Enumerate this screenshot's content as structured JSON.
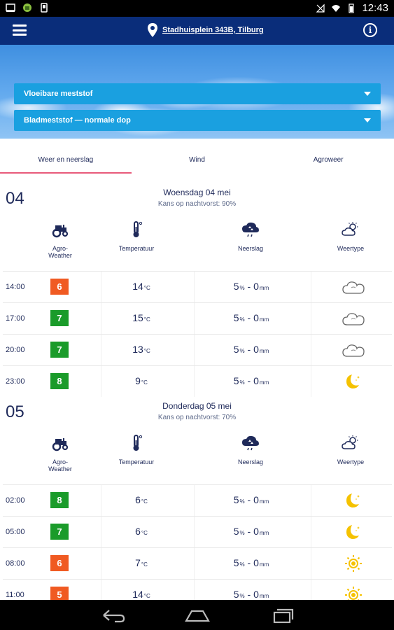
{
  "status_bar": {
    "time": "12:43"
  },
  "app_bar": {
    "location": "Stadhuisplein 343B, Tilburg"
  },
  "dropdowns": [
    {
      "label": "Vloeibare meststof"
    },
    {
      "label": "Bladmeststof — normale dop"
    }
  ],
  "tabs": [
    {
      "label": "Weer en neerslag",
      "active": true
    },
    {
      "label": "Wind",
      "active": false
    },
    {
      "label": "Agroweer",
      "active": false
    }
  ],
  "columns": {
    "agro": "Agro-\nWeather",
    "temp": "Temperatuur",
    "rain": "Neerslag",
    "type": "Weertype"
  },
  "units": {
    "temp": "°C",
    "chance": "%",
    "amount": "mm"
  },
  "days": [
    {
      "num": "04",
      "title": "Woensdag 04 mei",
      "subtitle": "Kans op nachtvorst: 90%",
      "rows": [
        {
          "time": "14:00",
          "agro": "6",
          "agro_color": "#f05a22",
          "temp": "14",
          "chance": "5",
          "amount": "0",
          "type": "cloud-icon"
        },
        {
          "time": "17:00",
          "agro": "7",
          "agro_color": "#1a9b2a",
          "temp": "15",
          "chance": "5",
          "amount": "0",
          "type": "cloud-icon"
        },
        {
          "time": "20:00",
          "agro": "7",
          "agro_color": "#1a9b2a",
          "temp": "13",
          "chance": "5",
          "amount": "0",
          "type": "cloud-icon"
        },
        {
          "time": "23:00",
          "agro": "8",
          "agro_color": "#1a9b2a",
          "temp": "9",
          "chance": "5",
          "amount": "0",
          "type": "moon-icon"
        }
      ]
    },
    {
      "num": "05",
      "title": "Donderdag 05 mei",
      "subtitle": "Kans op nachtvorst: 70%",
      "rows": [
        {
          "time": "02:00",
          "agro": "8",
          "agro_color": "#1a9b2a",
          "temp": "6",
          "chance": "5",
          "amount": "0",
          "type": "moon-icon"
        },
        {
          "time": "05:00",
          "agro": "7",
          "agro_color": "#1a9b2a",
          "temp": "6",
          "chance": "5",
          "amount": "0",
          "type": "moon-icon"
        },
        {
          "time": "08:00",
          "agro": "6",
          "agro_color": "#f05a22",
          "temp": "7",
          "chance": "5",
          "amount": "0",
          "type": "sun-icon"
        },
        {
          "time": "11:00",
          "agro": "5",
          "agro_color": "#f05a22",
          "temp": "14",
          "chance": "5",
          "amount": "0",
          "type": "sun-icon"
        }
      ]
    }
  ]
}
